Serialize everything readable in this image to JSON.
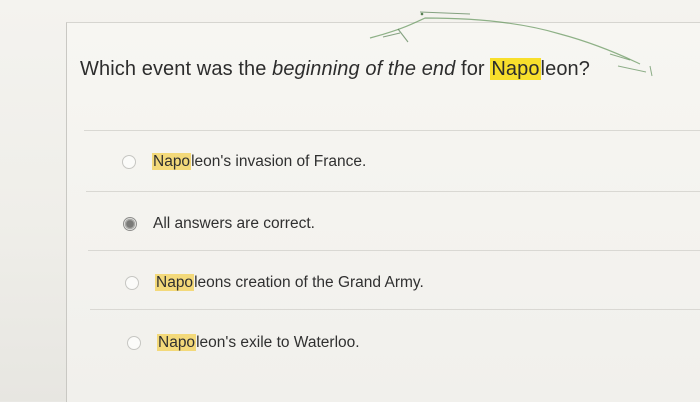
{
  "question": {
    "prefix": "Which event was the ",
    "emphasis": "beginning of the end",
    "middle": " for ",
    "highlight": "Napo",
    "suffix": "leon?"
  },
  "options": [
    {
      "highlight": "Napo",
      "rest": "leon's invasion of France.",
      "selected": false
    },
    {
      "highlight": "",
      "rest": "All answers are correct.",
      "selected": true
    },
    {
      "highlight": "Napo",
      "rest": "leons creation of the Grand Army.",
      "selected": false
    },
    {
      "highlight": "Napo",
      "rest": "leon's exile to Waterloo.",
      "selected": false
    }
  ]
}
